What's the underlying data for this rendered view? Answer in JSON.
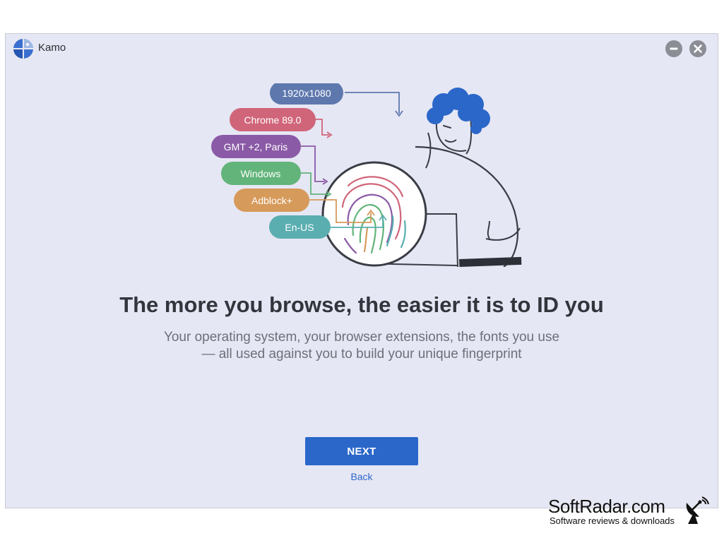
{
  "window": {
    "title": "Kamo"
  },
  "illustration": {
    "tags": [
      {
        "label": "1920x1080",
        "color": "#5e78ae"
      },
      {
        "label": "Chrome 89.0",
        "color": "#d0657a"
      },
      {
        "label": "GMT +2, Paris",
        "color": "#8a5aa6"
      },
      {
        "label": "Windows",
        "color": "#62b47a"
      },
      {
        "label": "Adblock+",
        "color": "#d69a5a"
      },
      {
        "label": "En-US",
        "color": "#5aaeb0"
      }
    ]
  },
  "content": {
    "headline": "The more you browse, the easier it is to ID you",
    "subtext_line1": "Your operating system, your browser extensions, the fonts you use",
    "subtext_line2": "— all used against you to build your unique fingerprint"
  },
  "actions": {
    "next_label": "NEXT",
    "back_label": "Back"
  },
  "watermark": {
    "title": "SoftRadar.com",
    "subtitle": "Software reviews & downloads"
  },
  "colors": {
    "accent": "#2b67c9",
    "background": "#e6e7f4"
  }
}
